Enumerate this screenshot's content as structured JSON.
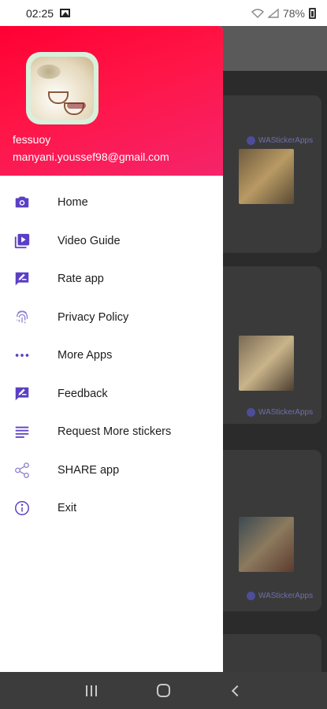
{
  "status_bar": {
    "time": "02:25",
    "battery": "78%"
  },
  "drawer": {
    "header": {
      "name": "fessuoy",
      "email": "manyani.youssef98@gmail.com"
    },
    "items": [
      {
        "label": "Home",
        "icon": "camera-icon"
      },
      {
        "label": "Video Guide",
        "icon": "video-library-icon"
      },
      {
        "label": "Rate app",
        "icon": "rate-review-icon"
      },
      {
        "label": "Privacy Policy",
        "icon": "fingerprint-icon"
      },
      {
        "label": "More Apps",
        "icon": "more-dots-icon"
      },
      {
        "label": "Feedback",
        "icon": "feedback-icon"
      },
      {
        "label": "Request More stickers",
        "icon": "list-lines-icon"
      },
      {
        "label": "SHARE app",
        "icon": "share-icon"
      },
      {
        "label": "Exit",
        "icon": "info-icon"
      }
    ]
  },
  "background": {
    "cards": [
      {
        "author": "WAStickerApps"
      },
      {
        "author": "WAStickerApps"
      },
      {
        "author": "WAStickerApps"
      }
    ]
  },
  "colors": {
    "header_start": "#ff0033",
    "header_end": "#f5246b",
    "icon_purple": "#5b3fc4"
  }
}
